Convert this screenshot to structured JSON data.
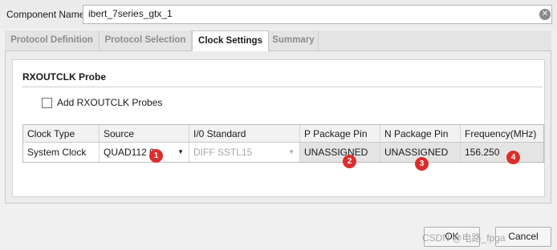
{
  "component": {
    "label": "Component Name",
    "value": "ibert_7series_gtx_1"
  },
  "tabs": [
    {
      "label": "Protocol Definition",
      "active": false
    },
    {
      "label": "Protocol Selection",
      "active": false
    },
    {
      "label": "Clock Settings",
      "active": true
    },
    {
      "label": "Summary",
      "active": false
    }
  ],
  "section": {
    "title": "RXOUTCLK Probe",
    "checkbox_label": "Add RXOUTCLK Probes",
    "checkbox_checked": false
  },
  "table": {
    "headers": [
      "Clock Type",
      "Source",
      "I/0 Standard",
      "P Package Pin",
      "N Package Pin",
      "Frequency(MHz)"
    ],
    "row": {
      "clock_type": "System Clock",
      "source": "QUAD112 0",
      "io_standard": "DIFF SSTL15",
      "p_pin": "UNASSIGNED",
      "n_pin": "UNASSIGNED",
      "frequency": "156.250"
    }
  },
  "markers": [
    "1",
    "2",
    "3",
    "4"
  ],
  "buttons": {
    "ok": "OK",
    "cancel": "Cancel"
  },
  "watermark": "CSDN @电路_fpga",
  "colors": {
    "marker": "#dc2d2d",
    "active_tab_bg": "#ffffff",
    "readonly_cell_bg": "#e4e4e4"
  }
}
